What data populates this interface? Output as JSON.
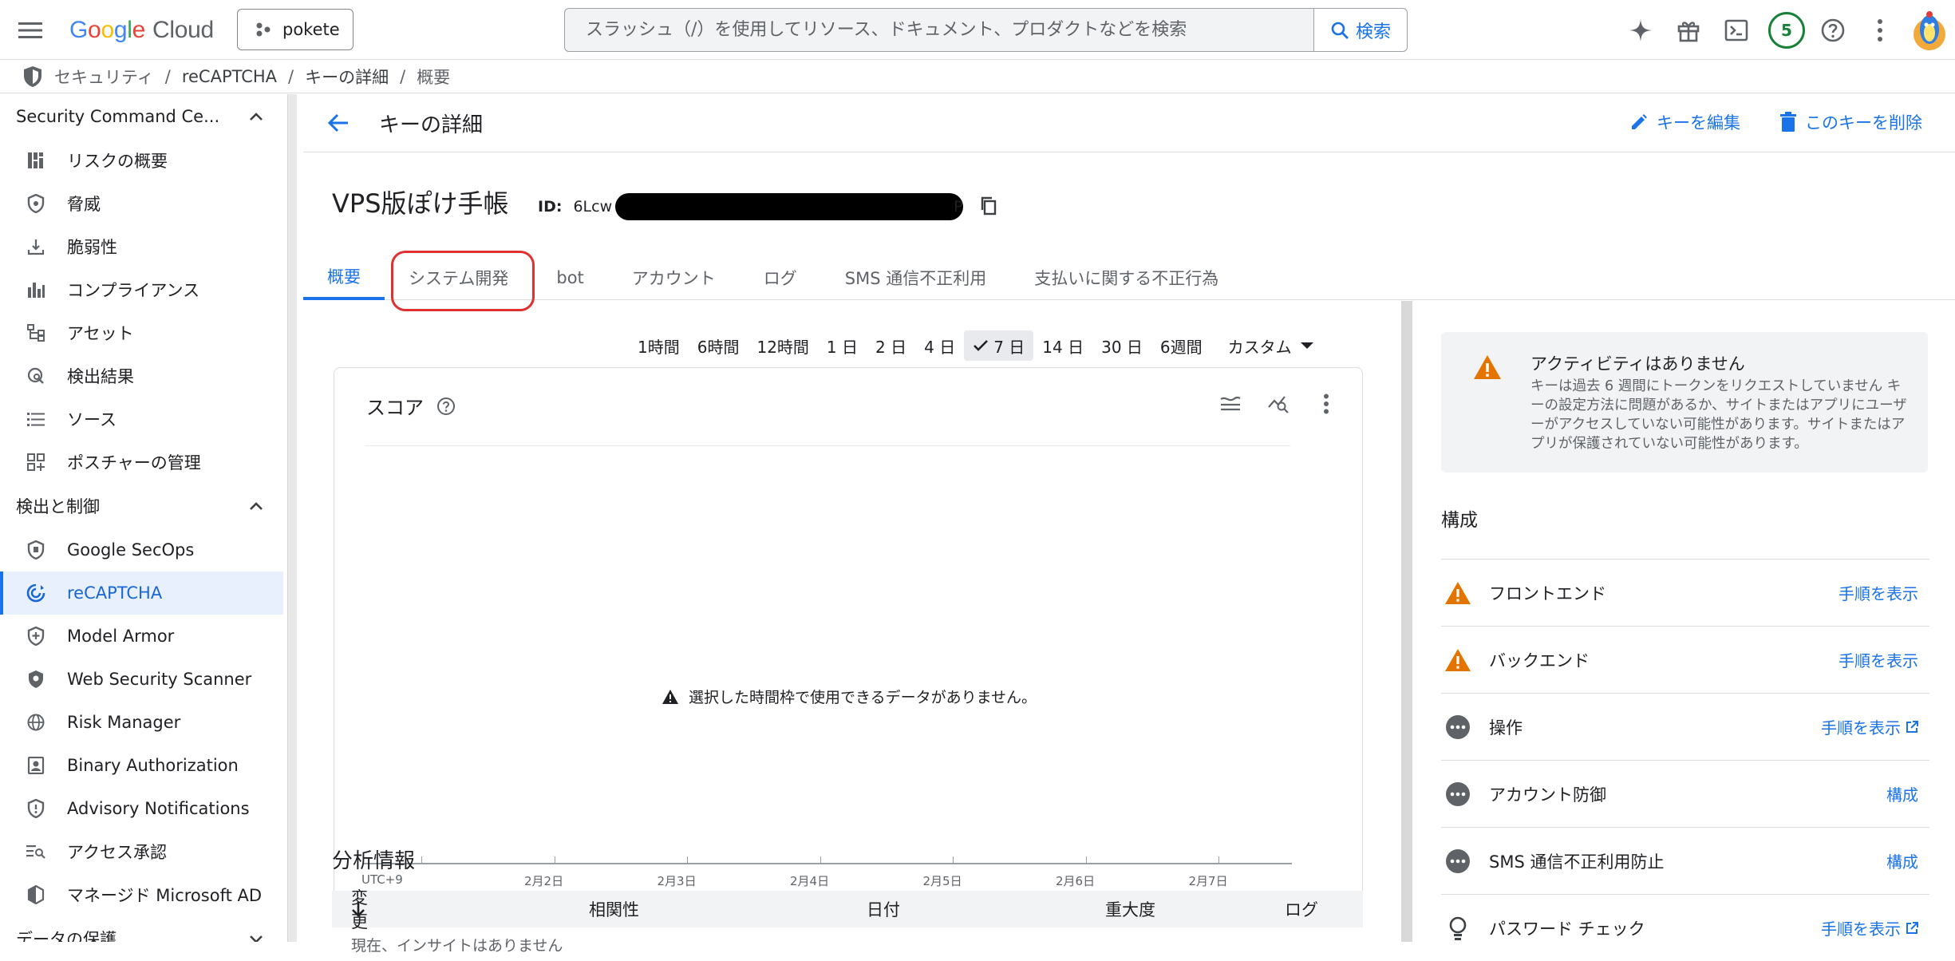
{
  "topbar": {
    "logo_google": [
      "G",
      "o",
      "o",
      "g",
      "l",
      "e"
    ],
    "logo_cloud": "Cloud",
    "project": "pokete",
    "search_placeholder": "スラッシュ（/）を使用してリソース、ドキュメント、プロダクトなどを検索",
    "search_button": "検索",
    "notifications_count": "5",
    "icons": [
      "menu-icon",
      "sparkle-icon",
      "gift-icon",
      "terminal-icon",
      "help-icon",
      "more-vert-icon"
    ]
  },
  "breadcrumb": [
    "セキュリティ",
    "reCAPTCHA",
    "キーの詳細",
    "概要"
  ],
  "sidebar": {
    "section1": "Security Command Ce...",
    "items1": [
      {
        "label": "リスクの概要",
        "icon": "dashboard-icon"
      },
      {
        "label": "脅威",
        "icon": "shield-icon"
      },
      {
        "label": "脆弱性",
        "icon": "download-icon"
      },
      {
        "label": "コンプライアンス",
        "icon": "bar-chart-icon"
      },
      {
        "label": "アセット",
        "icon": "tree-icon"
      },
      {
        "label": "検出結果",
        "icon": "search-globe-icon"
      },
      {
        "label": "ソース",
        "icon": "list-icon"
      },
      {
        "label": "ポスチャーの管理",
        "icon": "grid-icon"
      }
    ],
    "section2": "検出と制御",
    "items2": [
      {
        "label": "Google SecOps",
        "icon": "shield-outline-icon"
      },
      {
        "label": "reCAPTCHA",
        "icon": "recaptcha-icon",
        "active": true
      },
      {
        "label": "Model Armor",
        "icon": "shield-plus-icon"
      },
      {
        "label": "Web Security Scanner",
        "icon": "shield-filled-icon"
      },
      {
        "label": "Risk Manager",
        "icon": "globe-icon"
      },
      {
        "label": "Binary Authorization",
        "icon": "badge-icon"
      },
      {
        "label": "Advisory Notifications",
        "icon": "shield-alert-icon"
      },
      {
        "label": "アクセス承認",
        "icon": "list-search-icon"
      },
      {
        "label": "マネージド Microsoft AD",
        "icon": "ad-icon"
      }
    ],
    "section3": "データの保護"
  },
  "header": {
    "title": "キーの詳細",
    "edit": "キーを編集",
    "delete": "このキーを削除"
  },
  "key": {
    "name": "VPS版ぽけ手帳",
    "id_label": "ID:",
    "id_prefix": "6Lcw",
    "id_suffix": "P"
  },
  "tabs": [
    "概要",
    "システム開発",
    "bot",
    "アカウント",
    "ログ",
    "SMS 通信不正利用",
    "支払いに関する不正行為"
  ],
  "time_ranges": [
    "1時間",
    "6時間",
    "12時間",
    "1 日",
    "2 日",
    "4 日",
    "7 日",
    "14 日",
    "30 日",
    "6週間"
  ],
  "selected_range": "7 日",
  "custom_range": "カスタム",
  "score_card": {
    "title": "スコア",
    "no_data": "選択した時間枠で使用できるデータがありません。",
    "timezone": "UTC+9"
  },
  "chart_data": {
    "type": "line",
    "title": "スコア",
    "x": [
      "2月2日",
      "2月3日",
      "2月4日",
      "2月5日",
      "2月6日",
      "2月7日"
    ],
    "series": [],
    "xlabel": "UTC+9",
    "ylabel": "",
    "grid": false
  },
  "analysis": {
    "title": "分析情報",
    "columns": [
      "変更",
      "相関性",
      "日付",
      "重大度",
      "ログ"
    ],
    "empty": "現在、インサイトはありません"
  },
  "alert": {
    "title": "アクティビティはありません",
    "body": "キーは過去 6 週間にトークンをリクエストしていません キーの設定方法に問題があるか、サイトまたはアプリにユーザーがアクセスしていない可能性があります。サイトまたはアプリが保護されていない可能性があります。"
  },
  "config": {
    "title": "構成",
    "rows": [
      {
        "label": "フロントエンド",
        "action": "手順を表示",
        "status": "warning",
        "external": false
      },
      {
        "label": "バックエンド",
        "action": "手順を表示",
        "status": "warning",
        "external": false
      },
      {
        "label": "操作",
        "action": "手順を表示",
        "status": "pending",
        "external": true
      },
      {
        "label": "アカウント防御",
        "action": "構成",
        "status": "pending",
        "external": false
      },
      {
        "label": "SMS 通信不正利用防止",
        "action": "構成",
        "status": "pending",
        "external": false
      },
      {
        "label": "パスワード チェック",
        "action": "手順を表示",
        "status": "idea",
        "external": true
      }
    ]
  },
  "colors": {
    "accent": "#1a73e8",
    "warning": "#e37400",
    "highlight": "#e03030"
  }
}
